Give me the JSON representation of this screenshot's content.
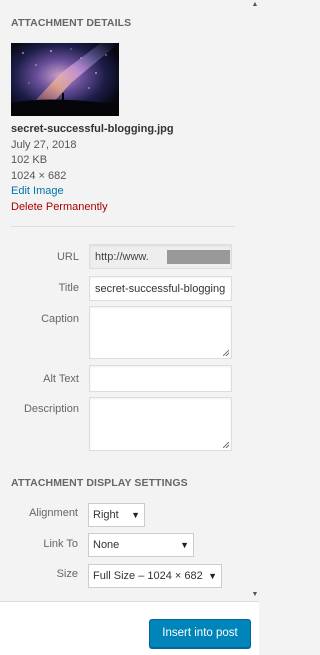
{
  "attachment_details": {
    "heading": "ATTACHMENT DETAILS",
    "filename": "secret-successful-blogging.jpg",
    "date": "July 27, 2018",
    "filesize": "102 KB",
    "dimensions": "1024 × 682",
    "edit_link": "Edit Image",
    "delete_link": "Delete Permanently"
  },
  "fields": {
    "url": {
      "label": "URL",
      "value": "http://www."
    },
    "title": {
      "label": "Title",
      "value": "secret-successful-blogging"
    },
    "caption": {
      "label": "Caption",
      "value": ""
    },
    "alt_text": {
      "label": "Alt Text",
      "value": ""
    },
    "description": {
      "label": "Description",
      "value": ""
    }
  },
  "display_settings": {
    "heading": "ATTACHMENT DISPLAY SETTINGS",
    "alignment": {
      "label": "Alignment",
      "selected": "Right"
    },
    "link_to": {
      "label": "Link To",
      "selected": "None"
    },
    "size": {
      "label": "Size",
      "selected": "Full Size – 1024 × 682"
    }
  },
  "footer": {
    "insert_button": "Insert into post"
  },
  "colors": {
    "link": "#0073aa",
    "delete": "#aa0000",
    "primary_button": "#0085ba"
  },
  "icons": {
    "caret": "chevron-down-icon",
    "scroll_up": "arrow-up-icon",
    "scroll_down": "arrow-down-icon"
  }
}
